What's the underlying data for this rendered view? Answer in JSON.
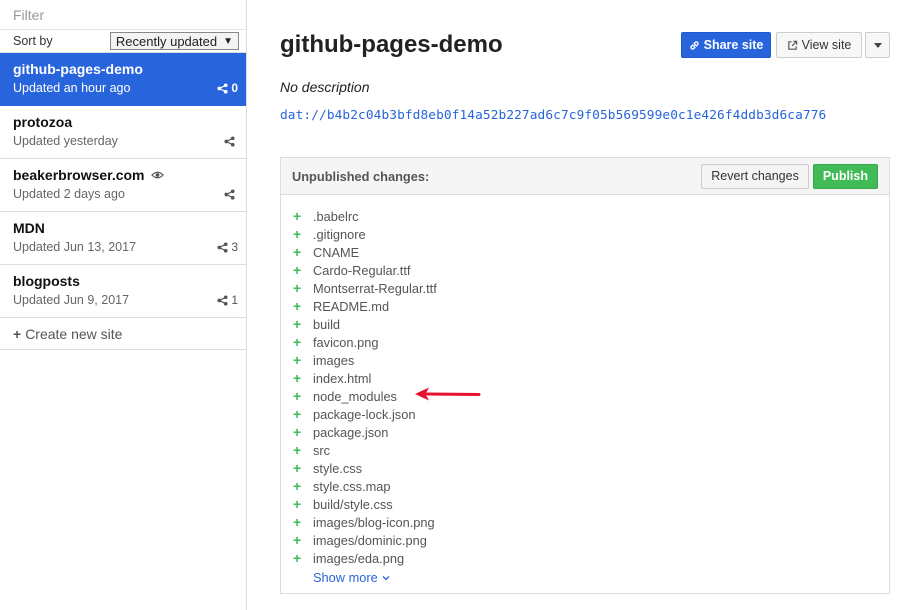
{
  "sidebar": {
    "filter_placeholder": "Filter",
    "sort_label": "Sort by",
    "sort_value": "Recently updated",
    "sites": [
      {
        "name": "github-pages-demo",
        "updated": "Updated an hour ago",
        "peers": "0",
        "active": true
      },
      {
        "name": "protozoa",
        "updated": "Updated yesterday",
        "peers": "",
        "active": false
      },
      {
        "name": "beakerbrowser.com",
        "updated": "Updated 2 days ago",
        "peers": "",
        "active": false,
        "icon": "eye-icon"
      },
      {
        "name": "MDN",
        "updated": "Updated Jun 13, 2017",
        "peers": "3",
        "active": false
      },
      {
        "name": "blogposts",
        "updated": "Updated Jun 9, 2017",
        "peers": "1",
        "active": false
      }
    ],
    "create_label": "Create new site"
  },
  "main": {
    "title": "github-pages-demo",
    "description": "No description",
    "url": "dat://b4b2c04b3bfd8eb0f14a52b227ad6c7c9f05b569599e0c1e426f4ddb3d6ca776",
    "share_label": "Share site",
    "view_label": "View site",
    "panel": {
      "title": "Unpublished changes:",
      "revert_label": "Revert changes",
      "publish_label": "Publish",
      "files": [
        ".babelrc",
        ".gitignore",
        "CNAME",
        "Cardo-Regular.ttf",
        "Montserrat-Regular.ttf",
        "README.md",
        "build",
        "favicon.png",
        "images",
        "index.html",
        "node_modules",
        "package-lock.json",
        "package.json",
        "src",
        "style.css",
        "style.css.map",
        "build/style.css",
        "images/blog-icon.png",
        "images/dominic.png",
        "images/eda.png"
      ],
      "show_more_label": "Show more"
    }
  },
  "colors": {
    "accent": "#2864dc",
    "publish": "#41bb56",
    "add": "#41bb56",
    "annotation_arrow": "#e8102f"
  }
}
